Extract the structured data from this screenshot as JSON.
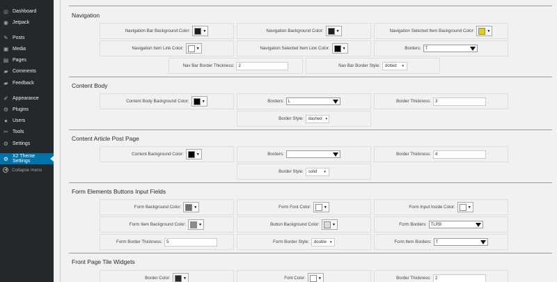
{
  "sidebar": {
    "items": [
      {
        "label": "Dashboard",
        "icon": "dashboard-icon",
        "glyph": "◎"
      },
      {
        "label": "Jetpack",
        "icon": "jetpack-icon",
        "glyph": "◉"
      },
      {
        "label": "Posts",
        "icon": "pin-icon",
        "glyph": "✎"
      },
      {
        "label": "Media",
        "icon": "media-icon",
        "glyph": "▣"
      },
      {
        "label": "Pages",
        "icon": "pages-icon",
        "glyph": "▤"
      },
      {
        "label": "Comments",
        "icon": "comments-icon",
        "glyph": "▰"
      },
      {
        "label": "Feedback",
        "icon": "feedback-icon",
        "glyph": "▰"
      },
      {
        "label": "Appearance",
        "icon": "appearance-icon",
        "glyph": "✐"
      },
      {
        "label": "Plugins",
        "icon": "plugins-icon",
        "glyph": "⚙"
      },
      {
        "label": "Users",
        "icon": "users-icon",
        "glyph": "●"
      },
      {
        "label": "Tools",
        "icon": "tools-icon",
        "glyph": "✂"
      },
      {
        "label": "Settings",
        "icon": "settings-icon",
        "glyph": "⚙"
      },
      {
        "label": "X2 Theme Settings",
        "icon": "gear-icon",
        "glyph": "⚙"
      },
      {
        "label": "Collapse menu",
        "icon": "collapse-icon",
        "glyph": "◀"
      }
    ]
  },
  "sections": {
    "navigation": {
      "title": "Navigation",
      "bar_bg_label": "Navigation Bar Background Color:",
      "bar_bg_color": "#1e1e1e",
      "bg_label": "Navigation Background Color:",
      "bg_color": "#1e1e1e",
      "sel_item_bg_label": "Navigation Selected Item Background Color:",
      "sel_item_bg_color": "#e3cd08",
      "item_link_label": "Navigation Item Link Color:",
      "item_link_color": "#ffffff",
      "sel_item_link_label": "Navigation Selected Item Link Color:",
      "sel_item_link_color": "#000000",
      "borders_label": "Borders:",
      "borders_value": "T",
      "bar_border_thick_label": "Nav Bar Border Thickness:",
      "bar_border_thick_value": "2",
      "bar_border_style_label": "Nav Bar Border Style:",
      "bar_border_style_value": "dotted"
    },
    "content_body": {
      "title": "Content Body",
      "bg_label": "Content Body Background Color:",
      "bg_color": "#000000",
      "borders_label": "Borders:",
      "borders_value": "L",
      "border_thick_label": "Border Thickness:",
      "border_thick_value": "3",
      "border_style_label": "Border Style:",
      "border_style_value": "dashed"
    },
    "content_article": {
      "title": "Content Article Post Page",
      "bg_label": "Content Background Color:",
      "bg_color": "#000000",
      "borders_label": "Borders:",
      "borders_value": "",
      "border_thick_label": "Border Thickness:",
      "border_thick_value": "4",
      "border_style_label": "Border Style:",
      "border_style_value": "solid"
    },
    "form_elements": {
      "title": "Form Elements Buttons Input Fields",
      "form_bg_label": "Form Background Color:",
      "form_bg_color": "#6e6e6e",
      "form_font_label": "Form Font Color:",
      "form_font_color": "#ffffff",
      "input_inside_label": "Form Input Inside Color:",
      "input_inside_color": "#ffffff",
      "item_bg_label": "Form Item Background Color:",
      "item_bg_color": "#8c8c8c",
      "button_bg_label": "Button Background Color:",
      "button_bg_color": "#dcdcdc",
      "form_borders_label": "Form Borders:",
      "form_borders_value": "TLRB",
      "border_thick_label": "Form Border Thickness:",
      "border_thick_value": "5",
      "border_style_label": "Form Border Style:",
      "border_style_value": "double",
      "item_borders_label": "Form Item Borders:",
      "item_borders_value": "T"
    },
    "front_page": {
      "title": "Front Page Tile Widgets",
      "border_color_label": "Border Color:",
      "border_color": "#2a2a2a",
      "font_color_label": "Font Color:",
      "font_color": "#ffffff",
      "border_thick_label": "Border Thickness:",
      "border_thick_value": "2"
    }
  }
}
